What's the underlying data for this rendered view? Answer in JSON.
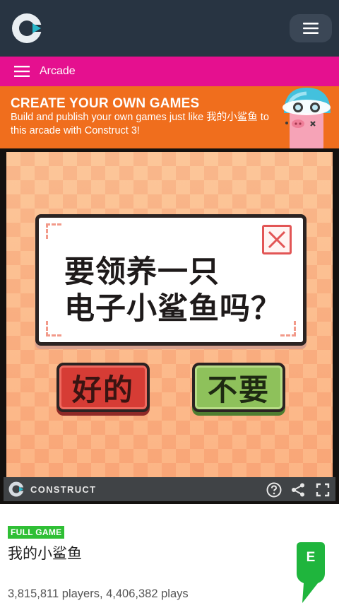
{
  "header": {
    "logo_icon": "construct-logo-icon",
    "menu_icon": "hamburger-icon"
  },
  "nav": {
    "label": "Arcade",
    "icon": "hamburger-icon"
  },
  "promo": {
    "title": "CREATE YOUR OWN GAMES",
    "body": "Build and publish your own games just like 我的小鲨鱼 to this arcade with Construct 3!",
    "mascot_icon": "pig-mascot-icon"
  },
  "game": {
    "question_line1": "要领养一只",
    "question_line2": "电子小鲨鱼吗？",
    "close_icon": "close-x-icon",
    "yes_label": "好的",
    "no_label": "不要"
  },
  "player": {
    "brand": "CONSTRUCT",
    "controls": [
      "help-icon",
      "share-icon",
      "fullscreen-icon"
    ]
  },
  "info": {
    "badge": "FULL GAME",
    "title": "我的小鲨鱼",
    "stats": "3,815,811 players, 4,406,382 plays",
    "rating_letter": "E"
  },
  "colors": {
    "header_bg": "#283442",
    "nav_bg": "#e5108f",
    "promo_bg": "#f06e1d",
    "badge_bg": "#2fbf35"
  }
}
